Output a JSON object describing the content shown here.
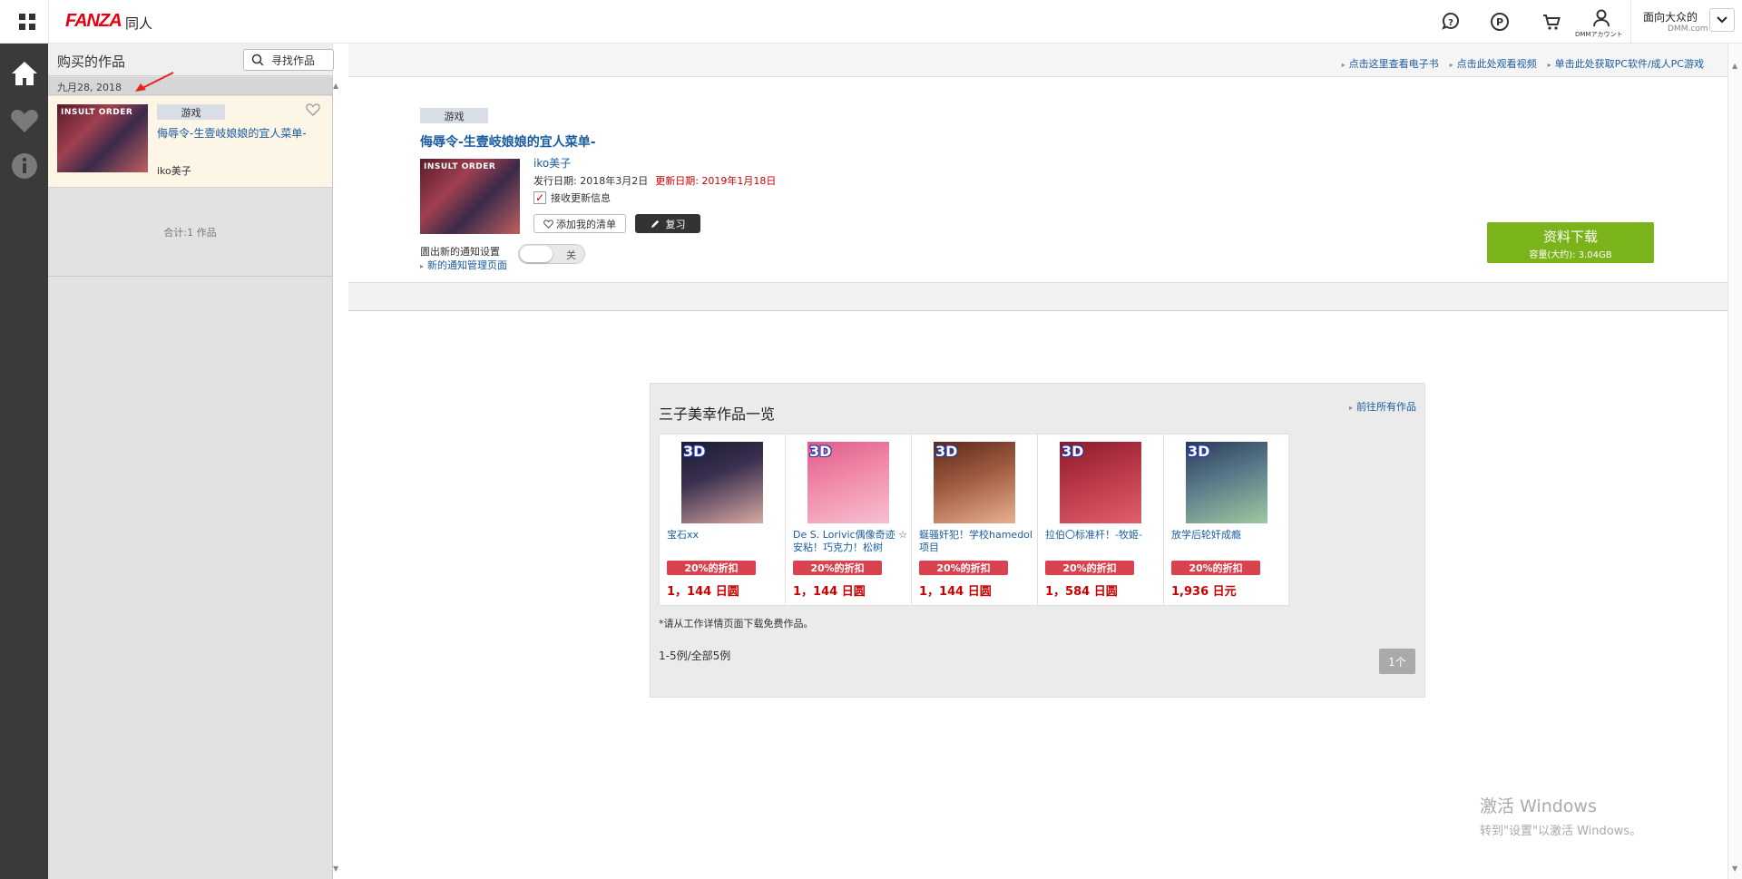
{
  "header": {
    "logo": "FANZA",
    "section": "同人",
    "account_label": "DMMアカウント",
    "user_name": "面向大众的",
    "user_sub": "DMM.com"
  },
  "list_panel": {
    "title": "购买的作品",
    "search_label": "寻找作品",
    "date": "九月28, 2018",
    "item": {
      "tag": "游戏",
      "title": "侮辱令-生壹岐娘娘的宜人菜单-",
      "maker": "iko美子",
      "thumb_text": "INSULT ORDER"
    },
    "total": "合计:1 作品"
  },
  "top_links": [
    "点击这里查看电子书",
    "点击此处观看视频",
    "单击此处获取PC软件/成人PC游戏"
  ],
  "detail": {
    "tag": "游戏",
    "title": "侮辱令-生壹岐娘娘的宜人菜单-",
    "maker": "iko美子",
    "release": "发行日期: 2018年3月2日",
    "updated": "更新日期: 2019年1月18日",
    "receive_updates": "接收更新信息",
    "wishlist": "添加我的清单",
    "review": "复习",
    "notify_setting": "圕出新的通知设置",
    "manage_page": "新的通知管理页面",
    "toggle_label": "关",
    "download_main": "资料下载",
    "download_sub": "容量(大约): 3.04GB"
  },
  "works": {
    "title": "三子美幸作品一览",
    "more": "前往所有作品",
    "items": [
      {
        "name": "宝石xx",
        "discount": "20%的折扣",
        "price": "1，144 日圆",
        "colors": [
          "#1a1a2e",
          "#d8a8a0"
        ]
      },
      {
        "name": "De S. Lorivic偶像奇迹 ☆安粘！巧克力！松树",
        "discount": "20%的折扣",
        "price": "1，144 日圆",
        "colors": [
          "#e05a8a",
          "#f7c0d0"
        ]
      },
      {
        "name": "蜒骚奸犯！学校hamedol项目",
        "discount": "20%的折扣",
        "price": "1，144 日圆",
        "colors": [
          "#5a2a1a",
          "#e8b090"
        ]
      },
      {
        "name": "拉伯〇标准杆！-牧姬-",
        "discount": "20%的折扣",
        "price": "1，584 日圆",
        "colors": [
          "#8a1a2a",
          "#e06070"
        ]
      },
      {
        "name": "放学后轮奸成瘾",
        "discount": "20%的折扣",
        "price": "1,936 日元",
        "colors": [
          "#2a3a5a",
          "#a0c8a0"
        ]
      }
    ],
    "label_3d": "3D",
    "note": "*请从工作详情页面下载免费作品。",
    "count": "1-5例/全部5例",
    "page": "1个"
  },
  "watermark": {
    "line1": "激活 Windows",
    "line2": "转到\"设置\"以激活 Windows。"
  },
  "colors": {
    "accent": "#e60012",
    "link": "#1a5ca0",
    "download": "#7bb31a",
    "discount": "#d9434f"
  }
}
